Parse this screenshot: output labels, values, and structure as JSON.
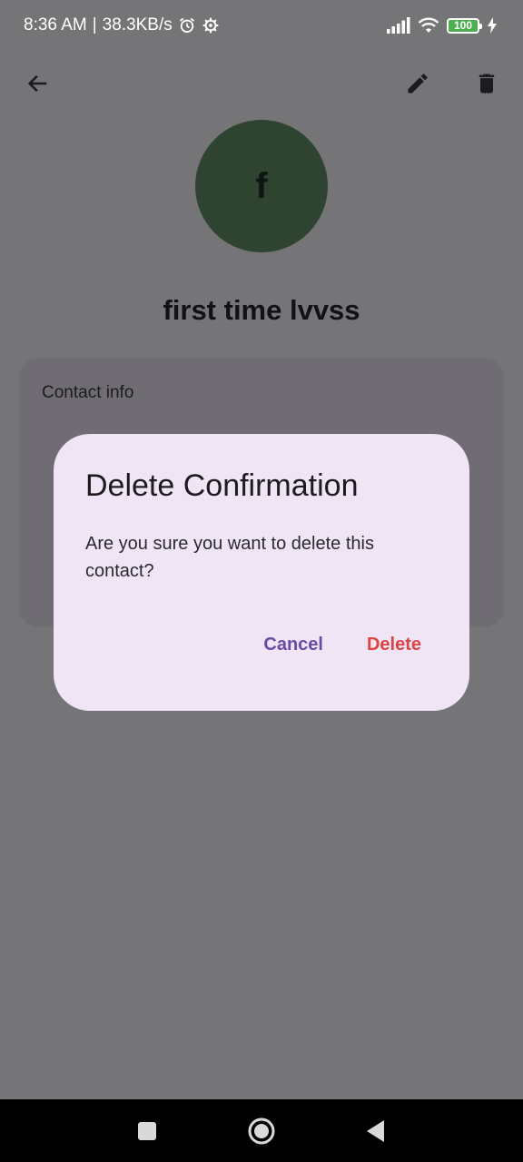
{
  "status_bar": {
    "time": "8:36 AM",
    "separator": "|",
    "speed": "38.3KB/s",
    "battery": "100",
    "icons": [
      "alarm-icon",
      "settings-icon",
      "signal-icon",
      "wifi-icon",
      "battery-icon",
      "charging-icon"
    ]
  },
  "app_bar": {
    "icons": [
      "back-arrow-icon",
      "edit-icon",
      "delete-icon"
    ]
  },
  "contact": {
    "avatar_letter": "f",
    "name": "first time lvvss",
    "avatar_color": "#2e4431"
  },
  "info_card": {
    "title": "Contact info"
  },
  "dialog": {
    "title": "Delete Confirmation",
    "body": "Are you sure you want to delete this contact?",
    "cancel_label": "Cancel",
    "delete_label": "Delete",
    "cancel_color": "#6a4aa6",
    "delete_color": "#dc4444",
    "background": "#efe5f5"
  },
  "nav_bar": {
    "icons": [
      "recents-icon",
      "home-icon",
      "back-icon"
    ]
  }
}
